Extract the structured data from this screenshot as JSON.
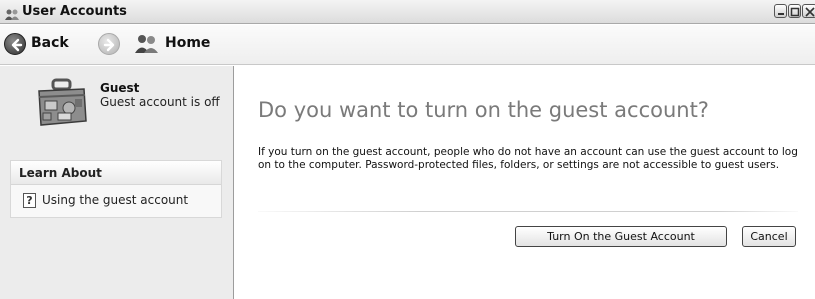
{
  "window": {
    "title": "User Accounts"
  },
  "nav": {
    "back_label": "Back",
    "home_label": "Home"
  },
  "account": {
    "name": "Guest",
    "status": "Guest account is off"
  },
  "learn_about": {
    "title": "Learn About",
    "items": [
      {
        "label": "Using the guest account"
      }
    ]
  },
  "main": {
    "title": "Do you want to turn on the guest account?",
    "description": "If you turn on the guest account, people who do not have an account can use the guest account to log on to the computer. Password-protected files, folders, or settings are not accessible to guest users.",
    "primary_button": "Turn On the Guest Account",
    "cancel_button": "Cancel"
  },
  "icons": {
    "title": "user-accounts-icon",
    "back": "back-arrow-icon",
    "forward": "forward-arrow-icon",
    "home": "users-home-icon",
    "avatar": "suitcase-icon",
    "help": "help-icon"
  }
}
